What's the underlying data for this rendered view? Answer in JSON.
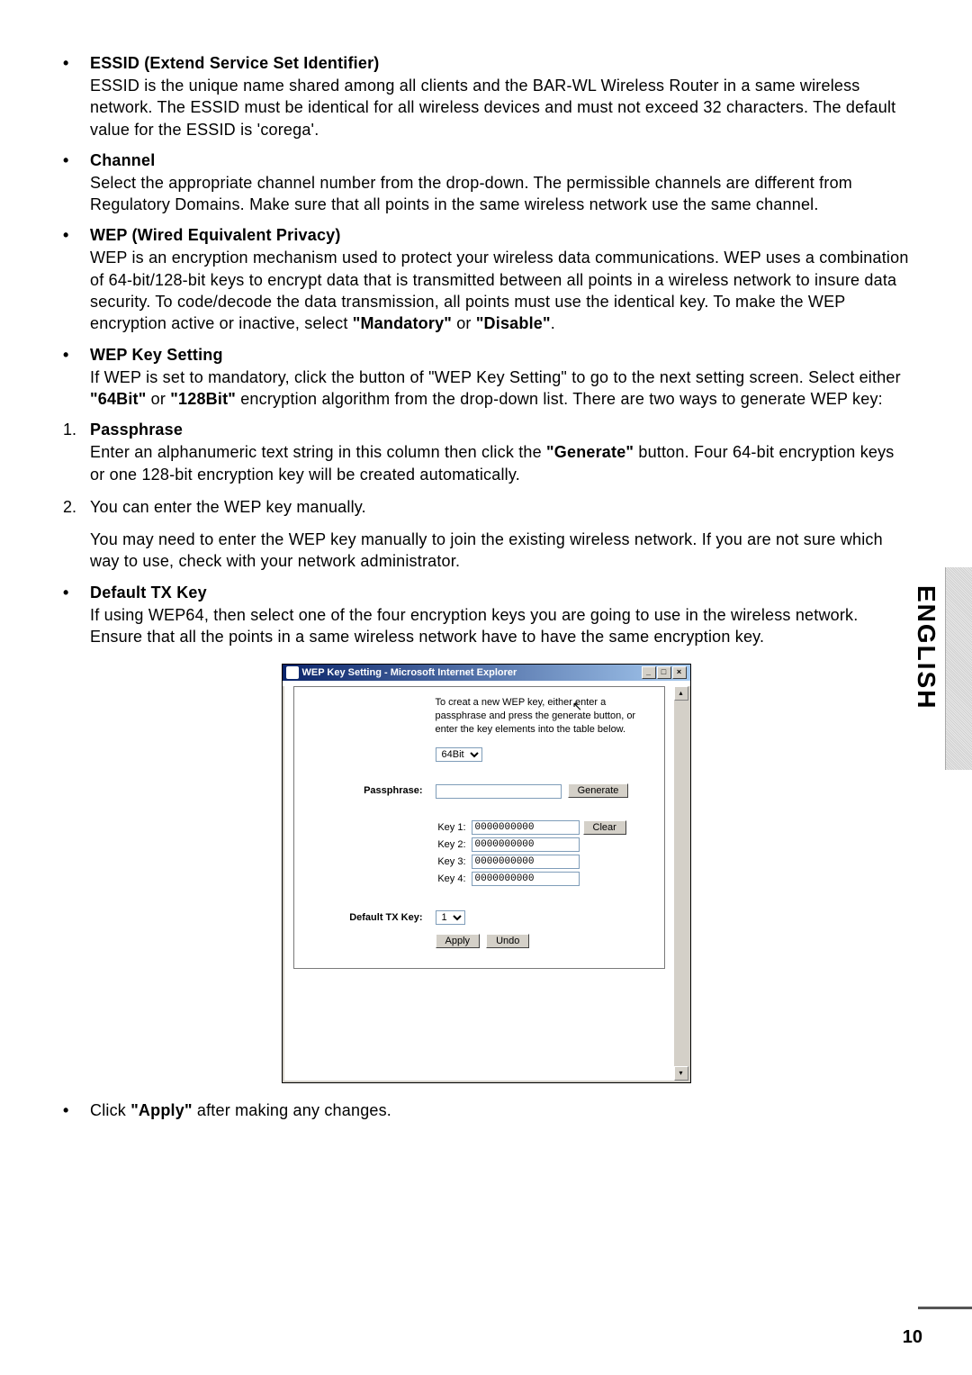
{
  "items": {
    "essid": {
      "title": "ESSID (Extend Service Set Identifier)",
      "desc_a": "ESSID is the unique name shared among all clients and the BAR-WL Wireless Router in a same wireless network. The ESSID must be identical for all wireless devices and must not exceed 32 characters. The default value for the ESSID is 'corega'."
    },
    "channel": {
      "title": "Channel",
      "desc_a": "Select the appropriate channel number from the drop-down. The permissible channels are different from Regulatory Domains. Make sure that all points in the same wireless network use the same channel."
    },
    "wep": {
      "title": "WEP (Wired Equivalent Privacy)",
      "desc_a": "WEP is an encryption mechanism used to protect your wireless data communications. WEP uses a combination of 64-bit/128-bit keys to encrypt data that is transmitted between all points in a wireless network to insure data security. To code/decode the data transmission, all points must use the identical key. To make the WEP encryption active or inactive, select ",
      "mand": "\"Mandatory\"",
      "or": " or ",
      "dis": "\"Disable\"",
      "dot": "."
    },
    "wepkey": {
      "title": "WEP Key Setting",
      "desc_a": "If WEP is set to mandatory, click the button of \"WEP Key Setting\" to go to the next setting screen. Select either ",
      "b64": "\"64Bit\"",
      "or": " or ",
      "b128": "\"128Bit\"",
      "desc_b": " encryption algorithm from the drop-down list. There are two ways to generate WEP key:"
    },
    "pass": {
      "num": "1.",
      "title": "Passphrase",
      "desc_a": "Enter an alphanumeric text string in this column then click the ",
      "gen": "\"Generate\"",
      "desc_b": " button. Four 64-bit encryption keys or one 128-bit encryption key will be created automatically."
    },
    "manual": {
      "num": "2.",
      "line1": "You can enter the WEP key manually.",
      "line2": "You may need to enter the WEP key manually to join the existing wireless network. If you are not sure which way to use, check with your network administrator."
    },
    "defaulttx": {
      "title": "Default TX Key",
      "desc_a": "If using WEP64, then select one of the four encryption keys you are going to use in the wireless network. Ensure that all the points in a same wireless network have to have the same encryption key."
    },
    "final": {
      "pre": "Click ",
      "apply": "\"Apply\"",
      "post": " after making any changes."
    }
  },
  "screenshot": {
    "title": "WEP Key Setting - Microsoft Internet Explorer",
    "intro": "To creat a new WEP key, either enter a passphrase and press the generate button, or enter the key elements into the table below.",
    "bitselect": "64Bit",
    "passphrase_label": "Passphrase:",
    "generate": "Generate",
    "clear": "Clear",
    "key1_label": "Key 1:",
    "key2_label": "Key 2:",
    "key3_label": "Key 3:",
    "key4_label": "Key 4:",
    "key1_val": "0000000000",
    "key2_val": "0000000000",
    "key3_val": "0000000000",
    "key4_val": "0000000000",
    "defaulttx_label": "Default TX Key:",
    "defaulttx_val": "1",
    "apply": "Apply",
    "undo": "Undo"
  },
  "side_label": "ENGLISH",
  "page_num": "10"
}
